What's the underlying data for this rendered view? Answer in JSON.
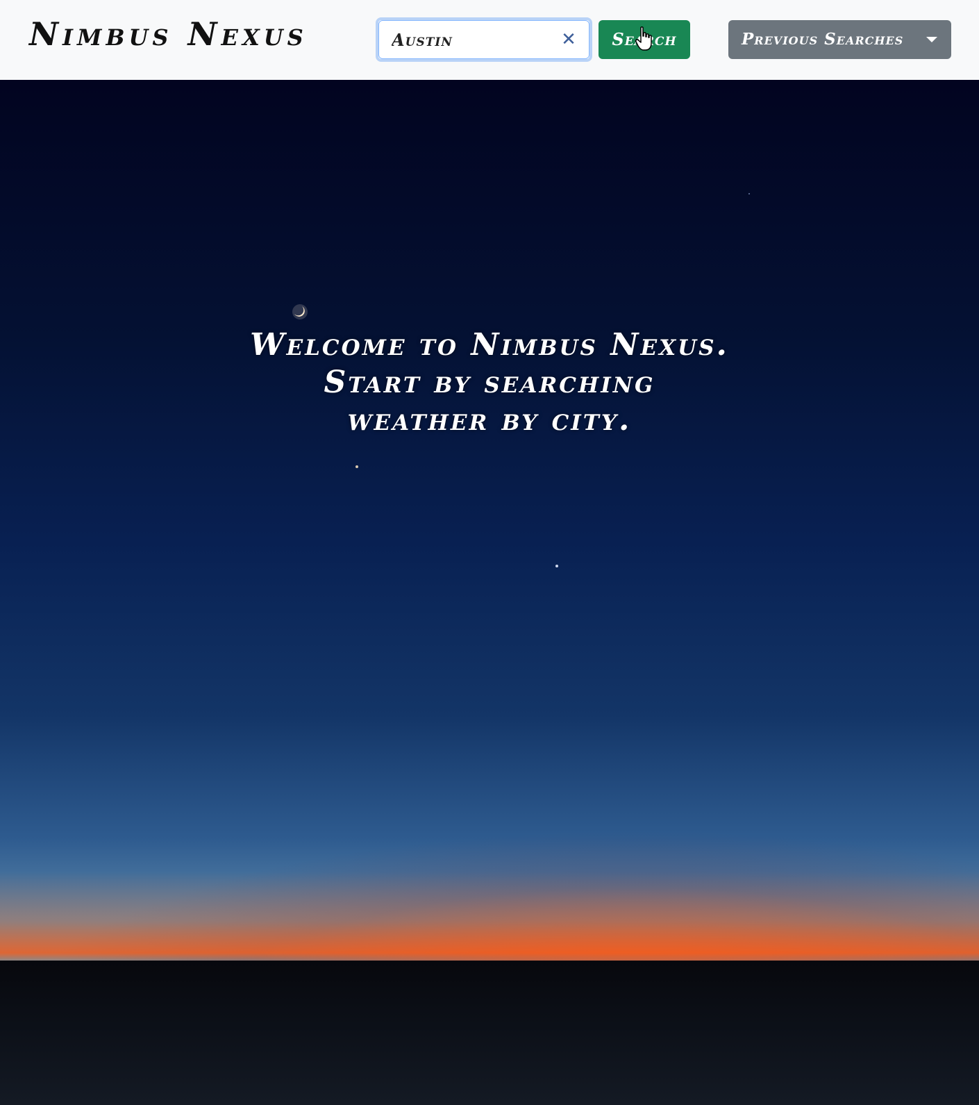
{
  "navbar": {
    "brand": "Nimbus Nexus",
    "search": {
      "value": "Austin",
      "placeholder": "",
      "clear_icon": "close-icon",
      "button_label": "Search"
    },
    "previous_searches": {
      "label": "Previous Searches",
      "icon": "caret-down-icon"
    }
  },
  "hero": {
    "welcome_lines": [
      "Welcome to Nimbus Nexus.",
      "Start by searching",
      "weather by city."
    ]
  },
  "colors": {
    "navbar_bg": "#f8f9fa",
    "search_button": "#198754",
    "previous_button": "#6c757d",
    "focus_ring": "#b9d3f7",
    "clear_icon": "#3e5f9a"
  }
}
